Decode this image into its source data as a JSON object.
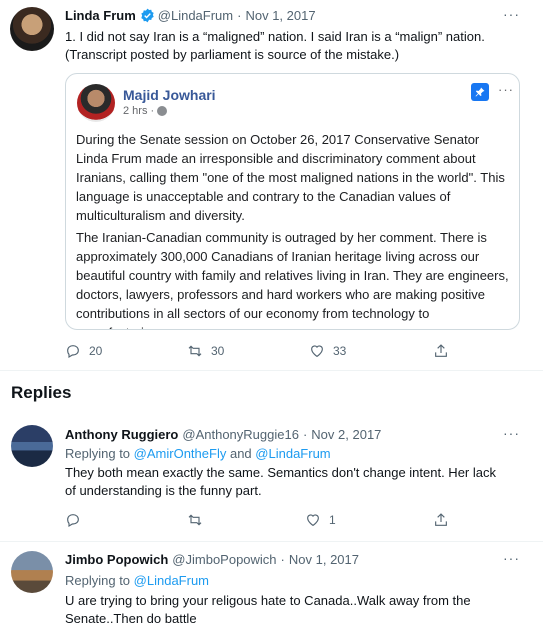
{
  "main_tweet": {
    "name": "Linda Frum",
    "handle": "@LindaFrum",
    "date": "Nov 1, 2017",
    "more": "···",
    "text": "1. I did not say Iran is a “maligned” nation. I said Iran is a “malign” nation. (Transcript posted by parliament is source of the mistake.)",
    "quote": {
      "author": "Majid Jowhari",
      "time": "2 hrs",
      "more": "···",
      "paragraph1": "During the Senate session on October 26, 2017 Conservative Senator Linda Frum made an irresponsible and discriminatory comment about Iranians, calling them \"one of the most maligned nations in the world\". This language is unacceptable and contrary to the Canadian values of multiculturalism and diversity.",
      "paragraph2": "The Iranian-Canadian community is outraged by her comment. There is approximately 300,000 Canadians of Iranian heritage living across our beautiful country with family and relatives living in Iran. They are engineers, doctors, lawyers, professors and hard workers who are making positive contributions in all sectors of our economy from technology to manufacturing."
    },
    "replies_count": "20",
    "retweets_count": "30",
    "likes_count": "33"
  },
  "replies_heading": "Replies",
  "replies": [
    {
      "name": "Anthony Ruggiero",
      "handle": "@AnthonyRuggie16",
      "date": "Nov 2, 2017",
      "replying_prefix": "Replying to",
      "replying_to_1": "@AmirOntheFly",
      "replying_and": "and",
      "replying_to_2": "@LindaFrum",
      "text": "They both mean exactly the same. Semantics don't change intent. Her lack of understanding is the funny part.",
      "likes_count": "1",
      "more": "···"
    },
    {
      "name": "Jimbo Popowich",
      "handle": "@JimboPopowich",
      "date": "Nov 1, 2017",
      "replying_prefix": "Replying to",
      "replying_to_1": "@LindaFrum",
      "text": "U are trying to bring your religous hate to Canada..Walk away from the Senate..Then do battle",
      "more": "···"
    }
  ],
  "colors": {
    "link": "#1d9bf0",
    "verified": "#1d9bf0",
    "muted": "#536471"
  }
}
